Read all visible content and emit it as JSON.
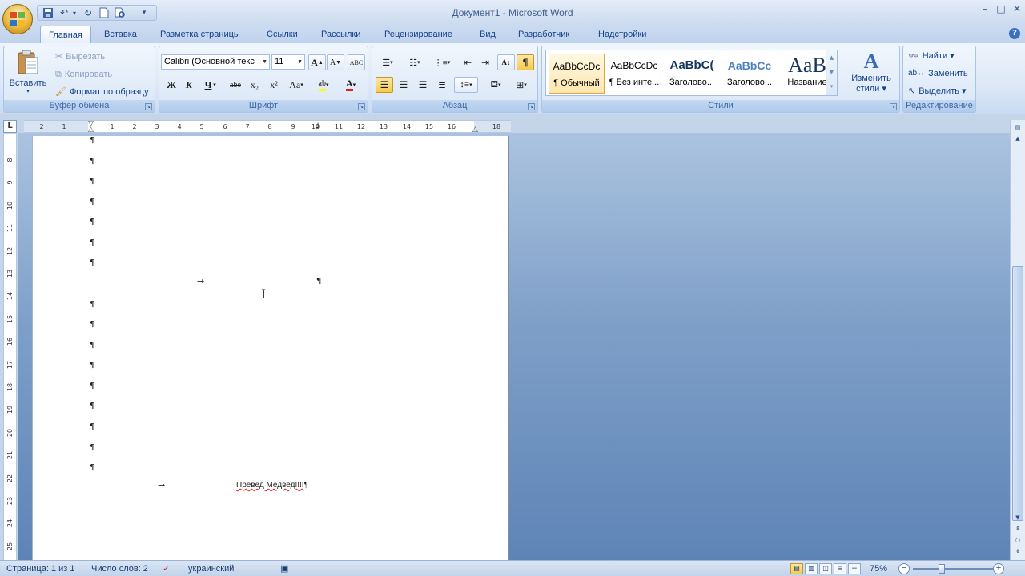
{
  "window": {
    "title": "Документ1 - Microsoft Word",
    "controls": [
      "–",
      "□",
      "✕"
    ]
  },
  "quick_access": {
    "icons": [
      "save-icon",
      "undo-icon",
      "redo-icon",
      "new-document-icon",
      "print-preview-icon",
      "customize-qat-icon"
    ]
  },
  "tabs": [
    {
      "label": "Главная",
      "active": true
    },
    {
      "label": "Вставка"
    },
    {
      "label": "Разметка страницы"
    },
    {
      "label": "Ссылки"
    },
    {
      "label": "Рассылки"
    },
    {
      "label": "Рецензирование"
    },
    {
      "label": "Вид"
    },
    {
      "label": "Разработчик"
    },
    {
      "label": "Надстройки"
    }
  ],
  "ribbon": {
    "clipboard": {
      "label": "Буфер обмена",
      "paste": "Вставить",
      "cut": "Вырезать",
      "copy": "Копировать",
      "format_painter": "Формат по образцу"
    },
    "font": {
      "label": "Шрифт",
      "font_name": "Calibri (Основной текс",
      "font_size": "11",
      "grow": "A",
      "shrink": "A",
      "clear": "ABC",
      "bold": "Ж",
      "italic": "К",
      "underline": "Ч",
      "strike": "abe",
      "subscript": "x₂",
      "superscript": "x²",
      "change_case": "Aa",
      "highlight": "ab",
      "font_color": "A"
    },
    "paragraph": {
      "label": "Абзац",
      "show_marks": "¶",
      "sort": "A↓"
    },
    "styles": {
      "label": "Стили",
      "items": [
        {
          "preview": "AaBbCcDc",
          "name": "¶ Обычный",
          "selected": true
        },
        {
          "preview": "AaBbCcDc",
          "name": "¶ Без инте..."
        },
        {
          "preview": "AaBbC(",
          "name": "Заголово..."
        },
        {
          "preview": "AaBbCc",
          "name": "Заголово..."
        },
        {
          "preview": "AaB",
          "name": "Название"
        }
      ],
      "change_styles": [
        "Изменить",
        "стили ▾"
      ]
    },
    "editing": {
      "label": "Редактирование",
      "find": "Найти ▾",
      "replace": "Заменить",
      "select": "Выделить ▾"
    }
  },
  "ruler": {
    "h_ticks": [
      "2",
      "1",
      "1",
      "2",
      "3",
      "4",
      "5",
      "6",
      "7",
      "8",
      "9",
      "10",
      "11",
      "12",
      "13",
      "14",
      "15",
      "16",
      "18"
    ],
    "v_ticks": [
      "8",
      "9",
      "10",
      "11",
      "12",
      "13",
      "14",
      "15",
      "16",
      "17",
      "18",
      "19",
      "20",
      "21",
      "22",
      "23",
      "24",
      "25",
      "26"
    ],
    "corner": "L"
  },
  "document": {
    "pilcrow": "¶",
    "tab_arrow": "→",
    "text": "Превед Медвед!!!!",
    "text_end": "¶"
  },
  "status": {
    "page": "Страница: 1 из 1",
    "words": "Число слов: 2",
    "language": "украинский",
    "zoom": "75%"
  },
  "colors": {
    "accent": "#15428b",
    "ribbon_bg": "#dde8f7",
    "workspace": "#7e9fc8",
    "selected_style": "#fde7b0"
  }
}
